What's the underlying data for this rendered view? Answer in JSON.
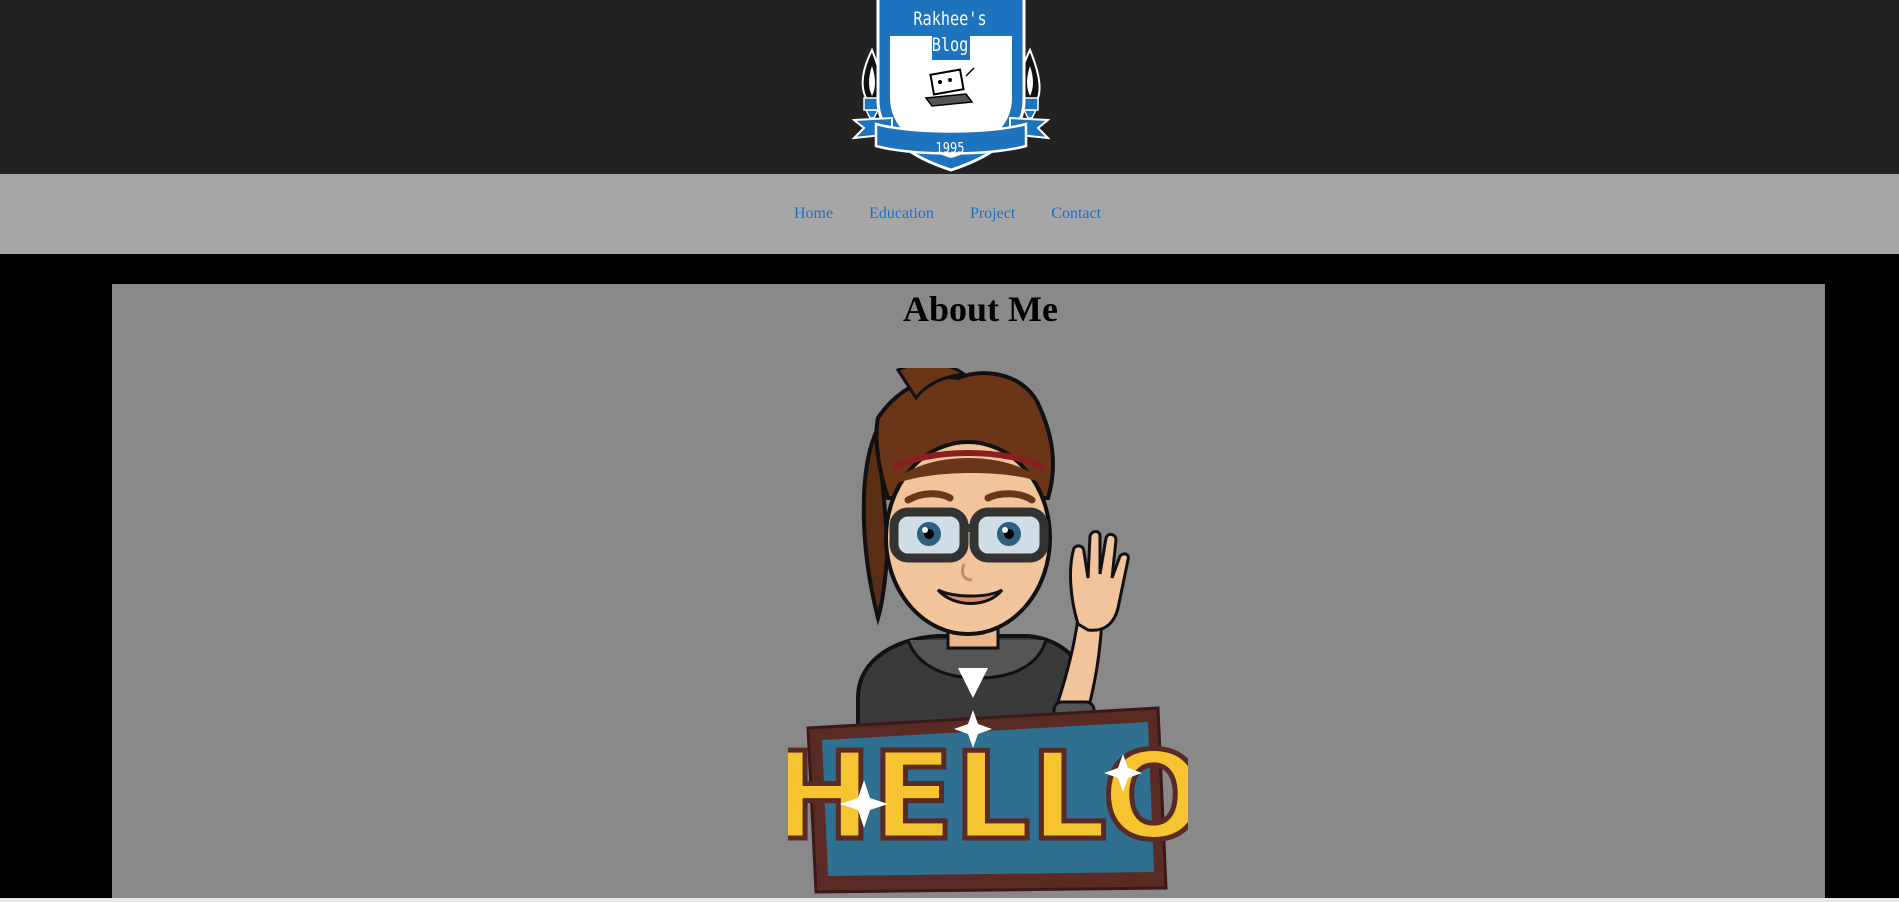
{
  "logo": {
    "line1": "Rakhee's",
    "line2": "Blog",
    "year": "1995",
    "icon": "crest-logo"
  },
  "nav": {
    "items": [
      "Home",
      "Education",
      "Project",
      "Contact"
    ]
  },
  "main": {
    "title": "About Me",
    "image": "bitmoji-hello-avatar",
    "image_text": "HELLO"
  },
  "colors": {
    "header_bg": "#222222",
    "nav_bg": "#a6a6a6",
    "link": "#1a6fc9",
    "page_bg": "#000000",
    "main_bg": "#898989",
    "logo_blue": "#1e73be"
  }
}
